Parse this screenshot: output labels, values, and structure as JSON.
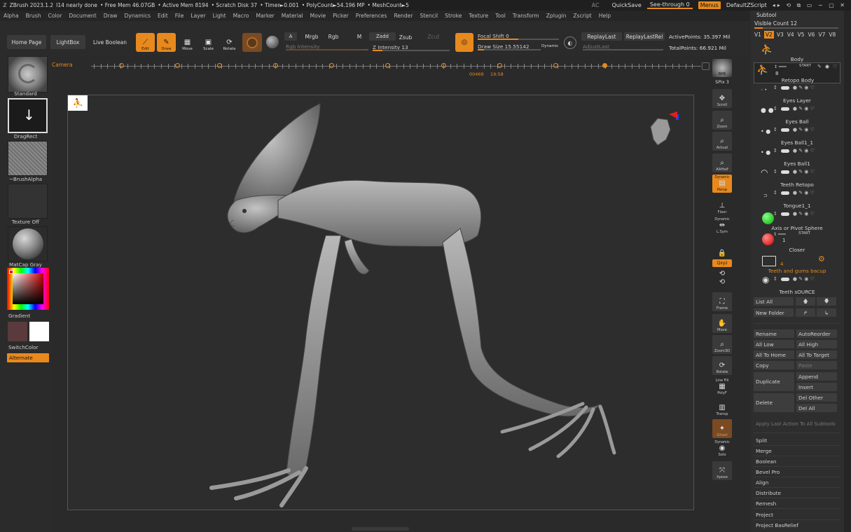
{
  "titlebar": {
    "app": "ZBrush 2023.1.2",
    "doc": "I14 nearly done",
    "free_mem": "• Free Mem 46.07GB",
    "active_mem": "• Active Mem 8194",
    "scratch": "• Scratch Disk 37",
    "timer": "• Timer►0.001",
    "polycount": "• PolyCount►54.196 MP",
    "meshcount": "• MeshCount►5",
    "ac": "AC",
    "quicksave": "QuickSave",
    "seethrough": "See-through  0",
    "menus": "Menus",
    "script": "DefaultZScript"
  },
  "menubar": [
    "Alpha",
    "Brush",
    "Color",
    "Document",
    "Draw",
    "Dynamics",
    "Edit",
    "File",
    "Layer",
    "Light",
    "Macro",
    "Marker",
    "Material",
    "Movie",
    "Picker",
    "Preferences",
    "Render",
    "Stencil",
    "Stroke",
    "Texture",
    "Tool",
    "Transform",
    "Zplugin",
    "Zscript",
    "Help"
  ],
  "shelf": {
    "home": "Home Page",
    "lightbox": "LightBox",
    "liveboolean": "Live Boolean",
    "edit": "Edit",
    "draw": "Draw",
    "move": "Move",
    "scale": "Scale",
    "rotate": "Rotate",
    "a": "A",
    "mrgb": "Mrgb",
    "rgb": "Rgb",
    "m": "M",
    "zadd": "Zadd",
    "zsub": "Zsub",
    "zcut": "Zcut",
    "rgb_intensity": "Rgb Intensity",
    "z_intensity": "Z Intensity 13",
    "z_intensity_value": 13,
    "focal_shift": "Focal Shift 0",
    "draw_size": "Draw Size 15.55142",
    "draw_size_value": 15.55142,
    "dynamic": "Dynamic",
    "replaylast": "ReplayLast",
    "replaylastrel": "ReplayLastRel",
    "adjustlast": "AdjustLast",
    "activepoints": "ActivePoints: 35.397 Mil",
    "totalpoints": "TotalPoints: 66.921 Mil"
  },
  "timeline": {
    "label": "Camera",
    "time": "00469",
    "time2": "19:58"
  },
  "leftpanel": {
    "standard": "Standard",
    "dragrect": "DragRect",
    "brushalpha": "~BrushAlpha",
    "textureoff": "Texture Off",
    "matcap": "MatCap Gray",
    "gradient": "Gradient",
    "switchcolor": "SwitchColor",
    "alternate": "Alternate"
  },
  "rtools": {
    "bpr": "BPR",
    "spix": "SPix 3",
    "scroll": "Scroll",
    "zoom": "Zoom",
    "actual": "Actual",
    "aahalf": "AAHalf",
    "dynamic": "Dynamic",
    "persp": "Persp",
    "floor": "Floor",
    "dynamic2": "Dynamic",
    "lsym": "L.Sym",
    "xyz": "Qxyz",
    "frame": "Frame",
    "move": "Move",
    "zoom3d": "Zoom3D",
    "rotate": "Rotate",
    "linefill": "Line Fill",
    "polyf": "PolyF",
    "transp": "Transp",
    "ghost": "Ghost",
    "dynamic3": "Dynamic",
    "solo": "Solo",
    "xpose": "Xpose"
  },
  "subtool": {
    "title": "Subtool",
    "visible_count": "Visible Count 12",
    "versions": [
      "V1",
      "V2",
      "V3",
      "V4",
      "V5",
      "V6",
      "V7",
      "V8"
    ],
    "start": "START",
    "items": [
      {
        "name": "Body"
      },
      {
        "name": "Retopo Body",
        "badge": "8"
      },
      {
        "name": "Eyes Layer"
      },
      {
        "name": "Eyes Ball"
      },
      {
        "name": "Eyes Ball1_1"
      },
      {
        "name": "Eyes Ball1"
      },
      {
        "name": "Teeth Retopo"
      },
      {
        "name": "Tongue1_1"
      },
      {
        "name": "Axis or Pivot Sphere"
      },
      {
        "name": "Closer",
        "badge": "1"
      },
      {
        "name": "Teeth and gums bacup",
        "badge": "4"
      },
      {
        "name": "Teeth sOURCE"
      }
    ],
    "buttons": {
      "listall": "List All",
      "newfolder": "New Folder",
      "rename": "Rename",
      "autoreorder": "AutoReorder",
      "alllow": "All Low",
      "allhigh": "All High",
      "alltohome": "All To Home",
      "alltotarget": "All To Target",
      "copy": "Copy",
      "paste": "Paste",
      "duplicate": "Duplicate",
      "append": "Append",
      "insert": "Insert",
      "delete": "Delete",
      "delother": "Del Other",
      "delall": "Del All",
      "applylast": "Apply Last Action To All Subtools",
      "split": "Split",
      "merge": "Merge",
      "boolean": "Boolean",
      "bevelpro": "Bevel Pro",
      "align": "Align",
      "distribute": "Distribute",
      "remesh": "Remesh",
      "project": "Project",
      "projectbas": "Project BasRelief"
    }
  },
  "colors": {
    "accent": "#e8891d",
    "primary_color": "#5a3a3c",
    "secondary_color": "#ffffff"
  }
}
